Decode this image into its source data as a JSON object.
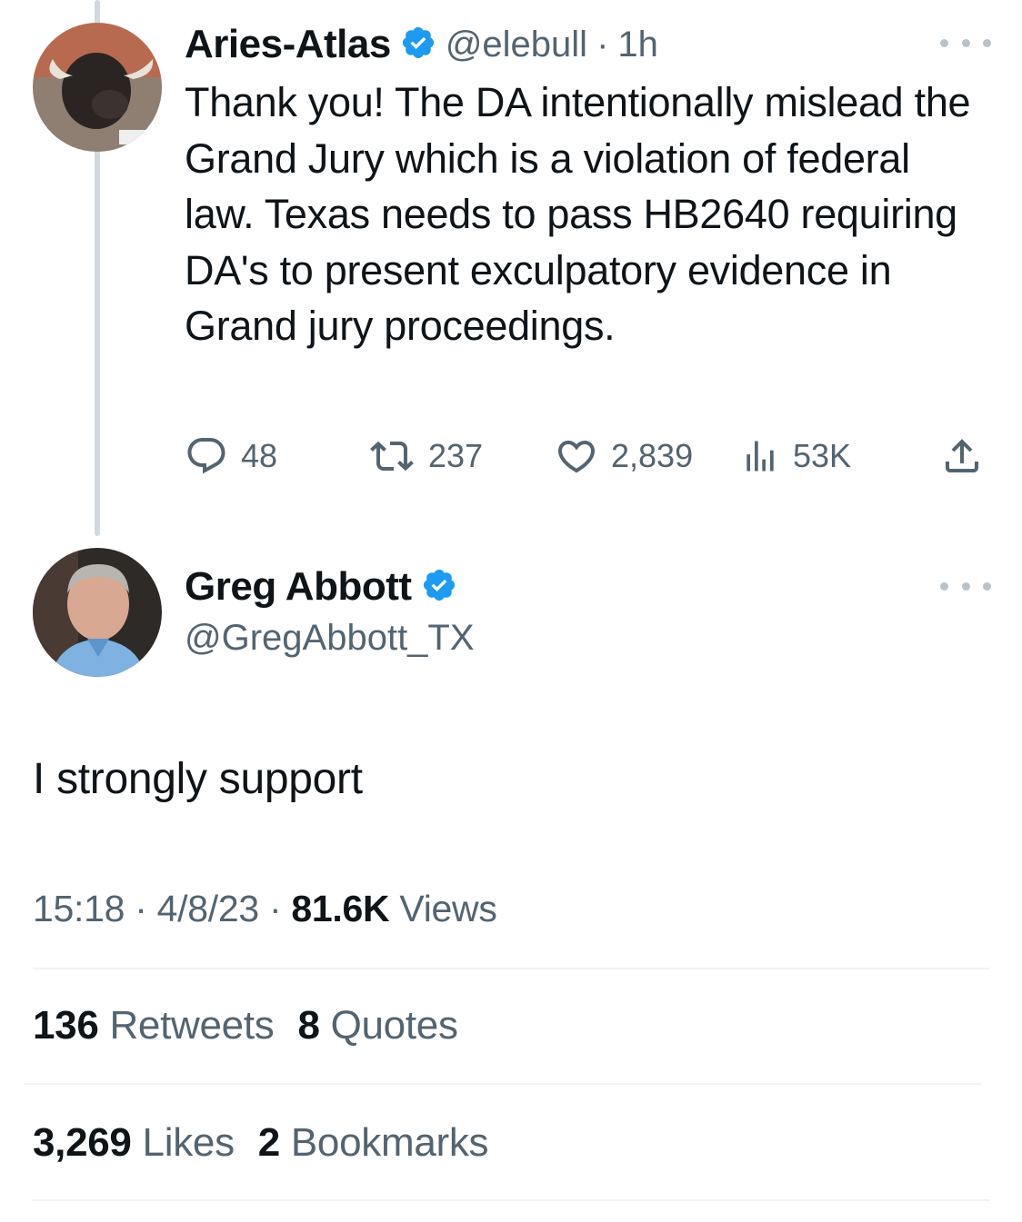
{
  "reply_tweet": {
    "author_name": "Aries-Atlas",
    "handle": "@elebull",
    "separator": "·",
    "time_ago": "1h",
    "text": "Thank you! The DA intentionally mislead the Grand Jury which is a violation of federal law. Texas needs to pass HB2640 requiring DA's to present exculpatory evidence in Grand jury proceedings.",
    "replies": "48",
    "retweets": "237",
    "likes": "2,839",
    "views": "53K"
  },
  "main_tweet": {
    "author_name": "Greg Abbott",
    "handle": "@GregAbbott_TX",
    "text": "I strongly support",
    "time": "15:18",
    "date": "4/8/23",
    "sep": "·",
    "views_count": "81.6K",
    "views_label": "Views",
    "retweets_count": "136",
    "retweets_label": "Retweets",
    "quotes_count": "8",
    "quotes_label": "Quotes",
    "likes_count": "3,269",
    "likes_label": "Likes",
    "bookmarks_count": "2",
    "bookmarks_label": "Bookmarks"
  },
  "icons": {
    "verified": "verified-badge-icon",
    "more": "more-icon",
    "reply": "reply-icon",
    "retweet": "retweet-icon",
    "like": "heart-icon",
    "views": "views-chart-icon",
    "share": "share-icon"
  },
  "colors": {
    "text": "#0f1419",
    "muted": "#536471",
    "verified_blue": "#1d9bf0",
    "thread_line": "#cfd9de",
    "divider": "#eff3f4"
  }
}
